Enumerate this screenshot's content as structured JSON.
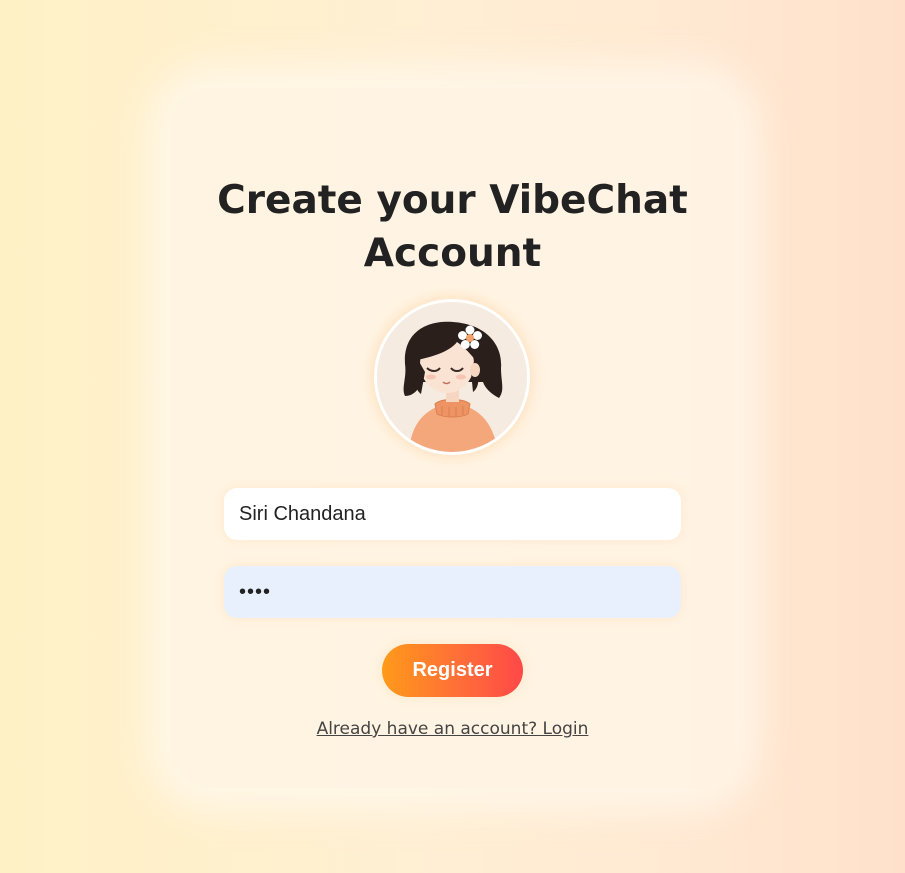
{
  "page": {
    "title": "Create your VibeChat Account"
  },
  "avatar": {
    "icon": "girl-avatar-illustration"
  },
  "form": {
    "username_value": "Siri Chandana",
    "password_value": "••••",
    "register_label": "Register",
    "login_link_text": "Already have an account? Login"
  },
  "colors": {
    "button_gradient_start": "#ff9a1a",
    "button_gradient_end": "#ff4848",
    "password_field_bg": "#e8effd"
  }
}
